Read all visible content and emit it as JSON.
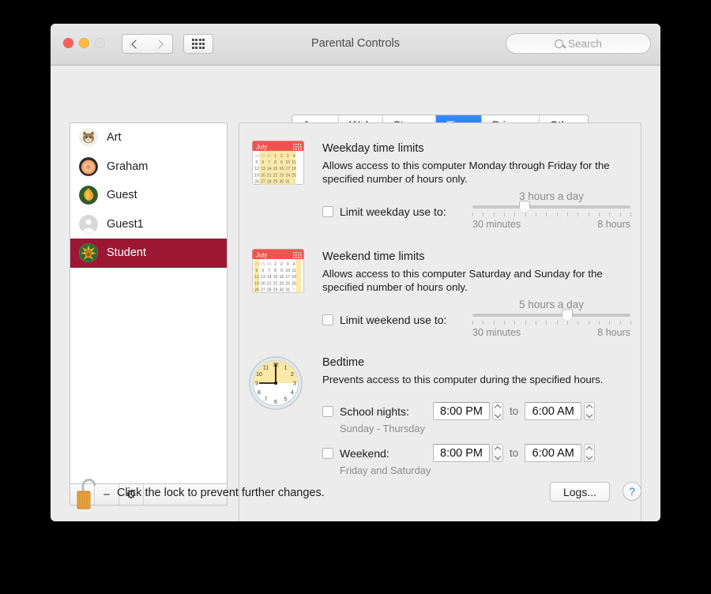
{
  "window": {
    "title": "Parental Controls",
    "traffic_lights": [
      "close-button",
      "minimize-button",
      "zoom-button"
    ],
    "nav": {
      "back": "back-icon",
      "forward": "forward-icon",
      "grid": "show-all-icon"
    }
  },
  "search": {
    "placeholder": "Search",
    "icon": "search-icon",
    "value": ""
  },
  "sidebar": {
    "users": [
      {
        "name": "Art",
        "avatar": "cat-avatar",
        "selected": false
      },
      {
        "name": "Graham",
        "avatar": "rose-avatar",
        "selected": false
      },
      {
        "name": "Guest",
        "avatar": "flower-avatar",
        "selected": false
      },
      {
        "name": "Guest1",
        "avatar": "person-avatar",
        "selected": false
      },
      {
        "name": "Student",
        "avatar": "sunflower-avatar",
        "selected": true
      }
    ],
    "toolbar": {
      "add": "+",
      "remove": "−",
      "gear": "⚙"
    },
    "selected_color": "#9c1733"
  },
  "tabs": [
    {
      "label": "Apps",
      "active": false
    },
    {
      "label": "Web",
      "active": false
    },
    {
      "label": "Stores",
      "active": false
    },
    {
      "label": "Time",
      "active": true
    },
    {
      "label": "Privacy",
      "active": false
    },
    {
      "label": "Other",
      "active": false
    }
  ],
  "accent_color": "#1a72f5",
  "weekday": {
    "icon": "calendar-weekday-icon",
    "calendar_month": "July",
    "title": "Weekday time limits",
    "description": "Allows access to this computer Monday through Friday for the specified number of hours only.",
    "checkbox_label": "Limit weekday use to:",
    "checked": false,
    "slider": {
      "value_label": "3 hours a day",
      "min_label": "30 minutes",
      "max_label": "8 hours",
      "percent": 33
    }
  },
  "weekend": {
    "icon": "calendar-weekend-icon",
    "calendar_month": "July",
    "title": "Weekend time limits",
    "description": "Allows access to this computer Saturday and Sunday for the specified number of hours only.",
    "checkbox_label": "Limit weekend use to:",
    "checked": false,
    "slider": {
      "value_label": "5 hours a day",
      "min_label": "30 minutes",
      "max_label": "8 hours",
      "percent": 60
    }
  },
  "bedtime": {
    "icon": "clock-icon",
    "title": "Bedtime",
    "description": "Prevents access to this computer during the specified hours.",
    "rows": [
      {
        "checkbox_label": "School nights:",
        "checked": false,
        "from": "8:00 PM",
        "to_label": "to",
        "until": "6:00 AM",
        "note": "Sunday - Thursday"
      },
      {
        "checkbox_label": "Weekend:",
        "checked": false,
        "from": "8:00 PM",
        "to_label": "to",
        "until": "6:00 AM",
        "note": "Friday and Saturday"
      }
    ]
  },
  "footer": {
    "lock_icon": "unlocked-padlock-icon",
    "lock_text": "Click the lock to prevent further changes.",
    "logs_label": "Logs...",
    "help_label": "?"
  },
  "calendar_grid": {
    "rows": [
      [
        "28",
        "29",
        "30",
        "1",
        "2",
        "3",
        "4"
      ],
      [
        "5",
        "6",
        "7",
        "8",
        "9",
        "10",
        "11"
      ],
      [
        "12",
        "13",
        "14",
        "15",
        "16",
        "17",
        "18"
      ],
      [
        "19",
        "20",
        "21",
        "22",
        "23",
        "24",
        "25"
      ],
      [
        "26",
        "27",
        "28",
        "29",
        "30",
        "31",
        "1"
      ]
    ]
  }
}
